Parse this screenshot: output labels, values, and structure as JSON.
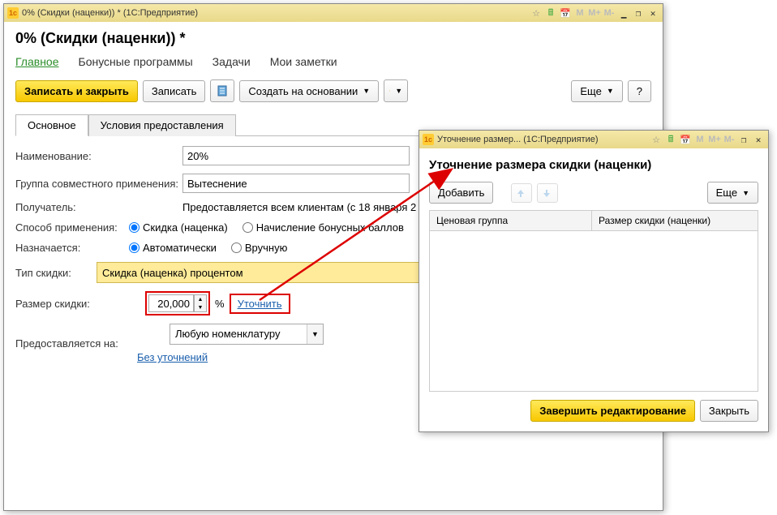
{
  "mainWindow": {
    "titlebar": "0% (Скидки (наценки)) *   (1С:Предприятие)",
    "pageTitle": "0% (Скидки (наценки)) *",
    "navTabs": {
      "main": "Главное",
      "bonus": "Бонусные программы",
      "tasks": "Задачи",
      "notes": "Мои заметки"
    },
    "toolbar": {
      "saveClose": "Записать и закрыть",
      "save": "Записать",
      "createBased": "Создать на основании",
      "more": "Еще",
      "help": "?"
    },
    "subTabs": {
      "basic": "Основное",
      "conditions": "Условия предоставления"
    },
    "form": {
      "nameLabel": "Наименование:",
      "nameValue": "20%",
      "groupLabel": "Группа совместного применения:",
      "groupValue": "Вытеснение",
      "recipientLabel": "Получатель:",
      "recipientText": "Предоставляется всем клиентам (с 18 января 2",
      "methodLabel": "Способ применения:",
      "methodOpt1": "Скидка (наценка)",
      "methodOpt2": "Начисление бонусных баллов",
      "assignLabel": "Назначается:",
      "assignOpt1": "Автоматически",
      "assignOpt2": "Вручную",
      "typeLabel": "Тип скидки:",
      "typeValue": "Скидка (наценка) процентом",
      "sizeLabel": "Размер скидки:",
      "sizeValue": "20,000",
      "percentSign": "%",
      "clarifyLink": "Уточнить",
      "provideLabel": "Предоставляется на:",
      "provideValue": "Любую номенклатуру",
      "noClarifyLink": "Без уточнений"
    }
  },
  "secondWindow": {
    "titlebar": "Уточнение размер...   (1С:Предприятие)",
    "title": "Уточнение размера скидки (наценки)",
    "toolbar": {
      "add": "Добавить",
      "more": "Еще"
    },
    "table": {
      "col1": "Ценовая группа",
      "col2": "Размер скидки (наценки)"
    },
    "footer": {
      "finish": "Завершить редактирование",
      "close": "Закрыть"
    }
  }
}
